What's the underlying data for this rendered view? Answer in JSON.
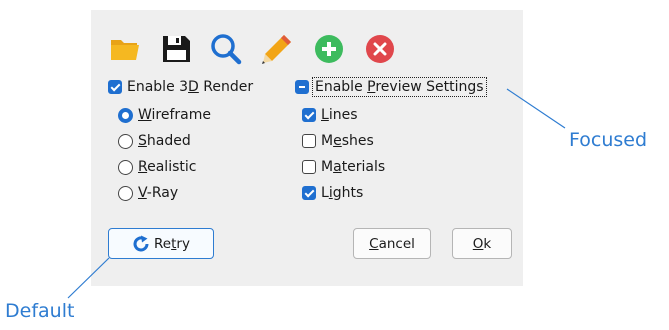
{
  "toolbar": {
    "icons": [
      "folder-icon",
      "save-icon",
      "search-icon",
      "pencil-icon",
      "add-icon",
      "close-icon"
    ]
  },
  "render": {
    "enable_label_pre": "Enable 3",
    "enable_label_ul": "D",
    "enable_label_post": " Render",
    "enable_checked": true,
    "options": [
      {
        "ul": "W",
        "rest": "ireframe",
        "selected": true
      },
      {
        "ul": "S",
        "rest": "haded",
        "selected": false
      },
      {
        "ul": "R",
        "rest": "ealistic",
        "selected": false
      },
      {
        "ul": "V",
        "rest": "-Ray",
        "selected": false
      }
    ]
  },
  "preview": {
    "enable_label_pre": "Enable ",
    "enable_label_ul": "P",
    "enable_label_post": "review Settings",
    "state": "indeterminate",
    "items": [
      {
        "pre": "",
        "ul": "L",
        "post": "ines",
        "checked": true
      },
      {
        "pre": "M",
        "ul": "e",
        "post": "shes",
        "checked": false
      },
      {
        "pre": "M",
        "ul": "a",
        "post": "terials",
        "checked": false
      },
      {
        "pre": "L",
        "ul": "i",
        "post": "ghts",
        "checked": true
      }
    ]
  },
  "buttons": {
    "retry_pre": "Re",
    "retry_ul": "t",
    "retry_post": "ry",
    "cancel_ul": "C",
    "cancel_post": "ancel",
    "ok_ul": "O",
    "ok_post": "k"
  },
  "callouts": {
    "focused": "Focused",
    "default": "Default"
  },
  "colors": {
    "accent": "#1f6fd0",
    "callout": "#2e7cd1",
    "dialog_bg": "#efefef"
  }
}
